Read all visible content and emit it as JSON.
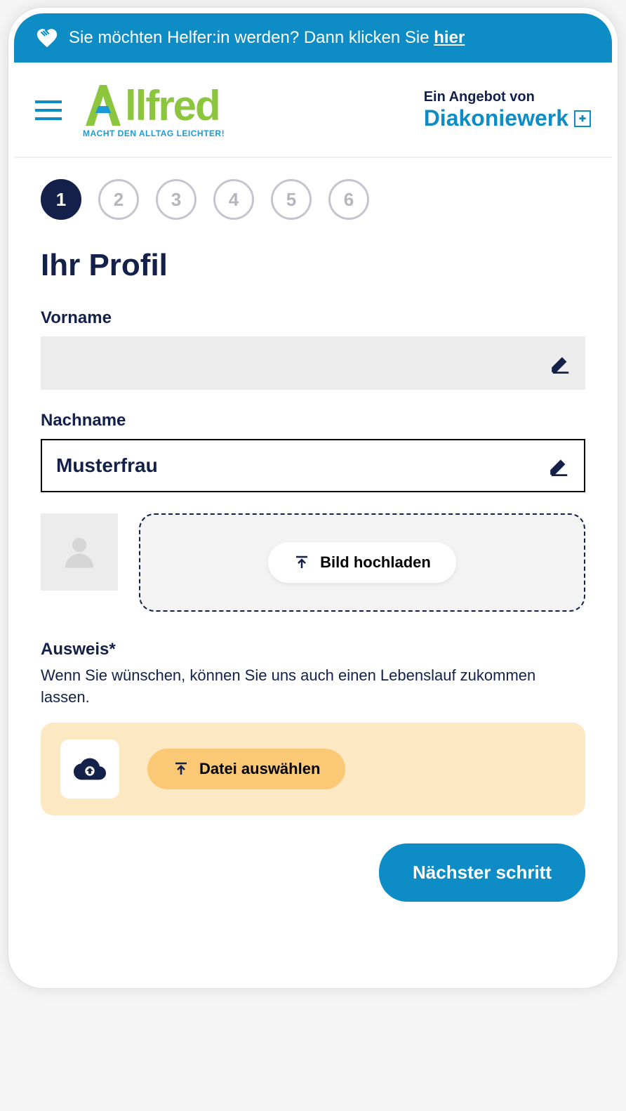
{
  "banner": {
    "text": "Sie möchten Helfer:in werden? Dann klicken Sie ",
    "link": "hier"
  },
  "header": {
    "logo_text": "llfred",
    "logo_tagline": "MACHT DEN ALLTAG LEICHTER!",
    "right_top": "Ein Angebot von",
    "right_bottom": "Diakoniewerk"
  },
  "steps": [
    "1",
    "2",
    "3",
    "4",
    "5",
    "6"
  ],
  "active_step": 0,
  "page_title": "Ihr Profil",
  "form": {
    "vorname_label": "Vorname",
    "vorname_value": "",
    "nachname_label": "Nachname",
    "nachname_value": "Musterfrau",
    "bild_hochladen": "Bild hochladen",
    "ausweis_label": "Ausweis*",
    "ausweis_desc": "Wenn Sie wünschen, können Sie uns auch einen Lebenslauf zukommen lassen.",
    "datei_auswaehlen": "Datei auswählen"
  },
  "next_button": "Nächster schritt"
}
